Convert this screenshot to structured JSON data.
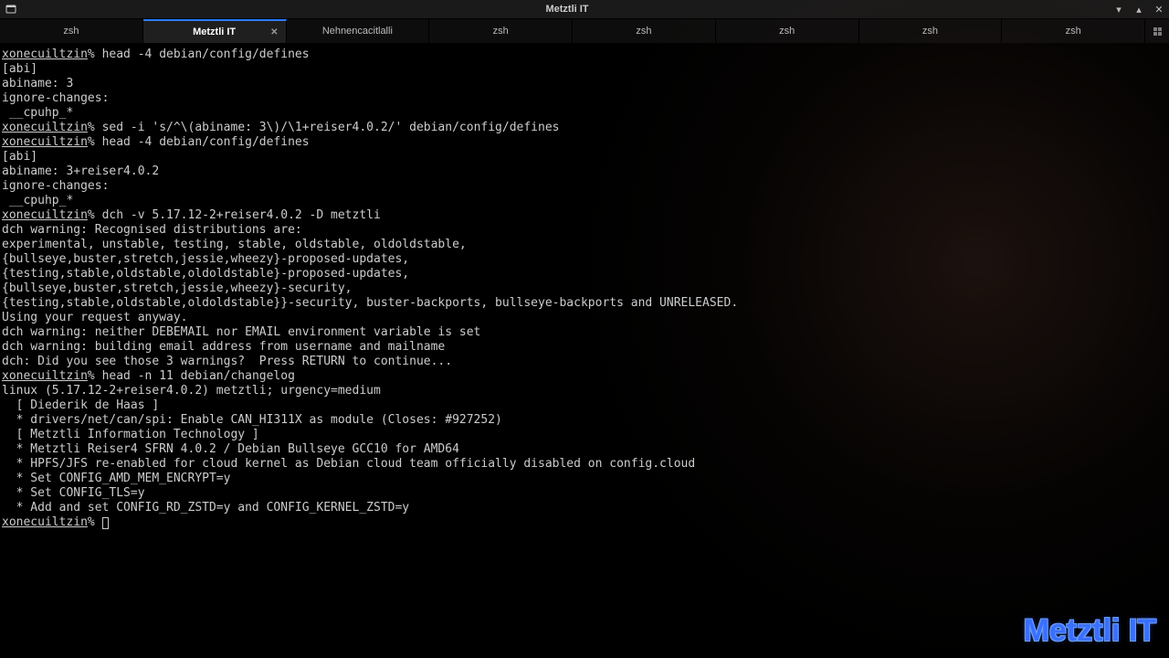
{
  "window": {
    "title": "Metztli IT",
    "minimize_glyph": "▾",
    "maximize_glyph": "▴",
    "close_glyph": "✕"
  },
  "tabs": [
    {
      "label": "zsh",
      "active": false
    },
    {
      "label": "Metztli IT",
      "active": true
    },
    {
      "label": "Nehnencacitlalli",
      "active": false
    },
    {
      "label": "zsh",
      "active": false
    },
    {
      "label": "zsh",
      "active": false
    },
    {
      "label": "zsh",
      "active": false
    },
    {
      "label": "zsh",
      "active": false
    },
    {
      "label": "zsh",
      "active": false
    }
  ],
  "tab_close_glyph": "✕",
  "prompt": {
    "host": "xonecuiltzin",
    "symbol": "%"
  },
  "terminal_lines": [
    {
      "prompt": true,
      "text": "head -4 debian/config/defines"
    },
    {
      "text": "[abi]"
    },
    {
      "text": "abiname: 3"
    },
    {
      "text": "ignore-changes:"
    },
    {
      "text": " __cpuhp_*"
    },
    {
      "prompt": true,
      "text": "sed -i 's/^\\(abiname: 3\\)/\\1+reiser4.0.2/' debian/config/defines"
    },
    {
      "prompt": true,
      "text": "head -4 debian/config/defines"
    },
    {
      "text": "[abi]"
    },
    {
      "text": "abiname: 3+reiser4.0.2"
    },
    {
      "text": "ignore-changes:"
    },
    {
      "text": " __cpuhp_*"
    },
    {
      "prompt": true,
      "text": "dch -v 5.17.12-2+reiser4.0.2 -D metztli"
    },
    {
      "text": "dch warning: Recognised distributions are:"
    },
    {
      "text": "experimental, unstable, testing, stable, oldstable, oldoldstable,"
    },
    {
      "text": "{bullseye,buster,stretch,jessie,wheezy}-proposed-updates,"
    },
    {
      "text": "{testing,stable,oldstable,oldoldstable}-proposed-updates,"
    },
    {
      "text": "{bullseye,buster,stretch,jessie,wheezy}-security,"
    },
    {
      "text": "{testing,stable,oldstable,oldoldstable}}-security, buster-backports, bullseye-backports and UNRELEASED."
    },
    {
      "text": "Using your request anyway."
    },
    {
      "text": "dch warning: neither DEBEMAIL nor EMAIL environment variable is set"
    },
    {
      "text": "dch warning: building email address from username and mailname"
    },
    {
      "text": "dch: Did you see those 3 warnings?  Press RETURN to continue..."
    },
    {
      "text": ""
    },
    {
      "prompt": true,
      "text": "head -n 11 debian/changelog"
    },
    {
      "text": "linux (5.17.12-2+reiser4.0.2) metztli; urgency=medium"
    },
    {
      "text": ""
    },
    {
      "text": "  [ Diederik de Haas ]"
    },
    {
      "text": "  * drivers/net/can/spi: Enable CAN_HI311X as module (Closes: #927252)"
    },
    {
      "text": ""
    },
    {
      "text": "  [ Metztli Information Technology ]"
    },
    {
      "text": "  * Metztli Reiser4 SFRN 4.0.2 / Debian Bullseye GCC10 for AMD64"
    },
    {
      "text": "  * HPFS/JFS re-enabled for cloud kernel as Debian cloud team officially disabled on config.cloud"
    },
    {
      "text": "  * Set CONFIG_AMD_MEM_ENCRYPT=y"
    },
    {
      "text": "  * Set CONFIG_TLS=y"
    },
    {
      "text": "  * Add and set CONFIG_RD_ZSTD=y and CONFIG_KERNEL_ZSTD=y"
    },
    {
      "prompt": true,
      "text": "",
      "cursor": true
    }
  ],
  "watermark": "Metztli IT"
}
